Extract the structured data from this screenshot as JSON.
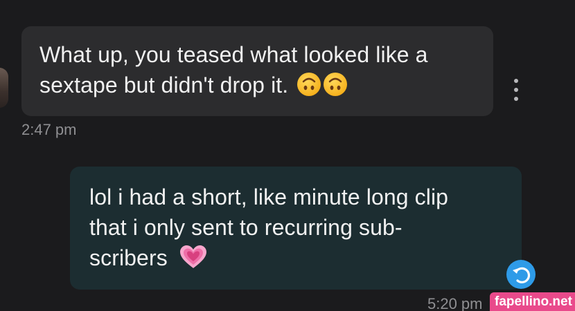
{
  "conversation": {
    "incoming": {
      "lines": [
        "What up, you teased what looked like a",
        "sextape but didn't drop it."
      ],
      "emojis": [
        "upside-down-face-emoji",
        "upside-down-face-emoji"
      ],
      "time": "2:47 pm"
    },
    "outgoing": {
      "lines": [
        "lol i had a short, like minute long clip",
        "that i only sent to recurring sub-",
        "scribers"
      ],
      "emojis": [
        "growing-heart-emoji"
      ],
      "time": "5:20 pm"
    }
  },
  "icons": {
    "more": "more-vertical-icon",
    "reply": "undo-arrow-icon"
  },
  "watermark": "fapellino.net",
  "colors": {
    "background": "#1b1b1d",
    "incoming_bubble": "#2c2c2e",
    "outgoing_bubble": "#1c2d31",
    "reply_button": "#2e9be8",
    "watermark": "#e94a8b"
  }
}
